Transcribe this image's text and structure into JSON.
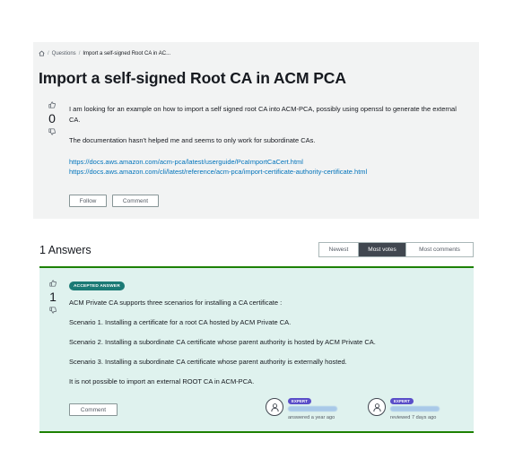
{
  "breadcrumb": {
    "home_icon": "home-icon",
    "items": [
      "Questions",
      "Import a self-signed Root CA in AC..."
    ]
  },
  "question": {
    "title": "Import a self-signed Root CA in ACM PCA",
    "votes": "0",
    "paragraphs": [
      "I am looking for an example on how to import a self signed root CA into ACM-PCA, possibly using openssl to generate the external CA.",
      "The documentation hasn't helped me and seems to only work for subordinate CAs."
    ],
    "links": [
      "https://docs.aws.amazon.com/acm-pca/latest/userguide/PcaImportCaCert.html",
      "https://docs.aws.amazon.com/cli/latest/reference/acm-pca/import-certificate-authority-certificate.html"
    ],
    "follow_label": "Follow",
    "comment_label": "Comment"
  },
  "answers": {
    "header": "1 Answers",
    "sort_options": [
      "Newest",
      "Most votes",
      "Most comments"
    ],
    "active_sort": "Most votes",
    "accepted": {
      "badge": "ACCEPTED ANSWER",
      "votes": "1",
      "paragraphs": [
        "ACM Private CA supports three scenarios for installing a CA certificate :",
        "Scenario 1. Installing a certificate for a root CA hosted by ACM Private CA.",
        "Scenario 2. Installing a subordinate CA certificate whose parent authority is hosted by ACM Private CA.",
        "Scenario 3. Installing a subordinate CA certificate whose parent authority is externally hosted.",
        "It is not possible to import an external ROOT CA in ACM-PCA."
      ],
      "comment_label": "Comment",
      "answerer": {
        "badge": "EXPERT",
        "time": "answered a year ago"
      },
      "reviewer": {
        "badge": "EXPERT",
        "time": "reviewed 7 days ago"
      }
    }
  },
  "colors": {
    "accepted_border": "#1d8102",
    "accepted_bg": "#dff2ee",
    "link": "#0073bb",
    "expert_badge": "#5a4ec9"
  }
}
